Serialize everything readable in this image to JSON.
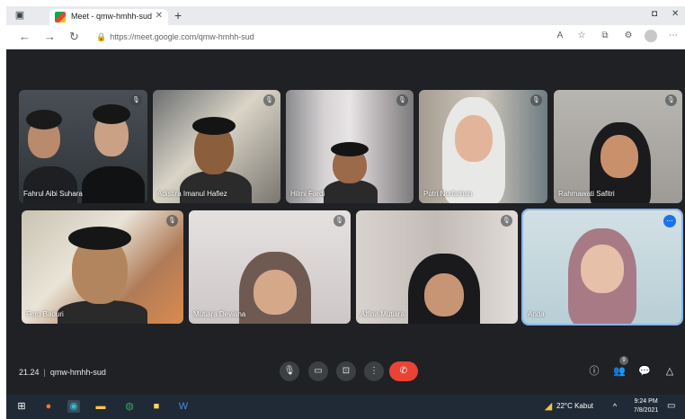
{
  "browser": {
    "tab_title": "Meet - qmw-hmhh-sud",
    "url": "https://meet.google.com/qmw-hmhh-sud",
    "new_tab": "+",
    "icons": [
      "back-arrow-icon",
      "forward-arrow-icon",
      "reload-icon",
      "lock-icon",
      "read-aloud-icon",
      "favorites-icon",
      "collections-icon",
      "extensions-icon",
      "profile-icon",
      "menu-icon"
    ]
  },
  "participants": [
    {
      "name": "Fahrul Aibi Suhara"
    },
    {
      "name": "Adistira Imanul Hafiez"
    },
    {
      "name": "Hilmi Fardi"
    },
    {
      "name": "Putri Nurfarhan"
    },
    {
      "name": "Rahmawati Safitri"
    },
    {
      "name": "Fero Baduri"
    },
    {
      "name": "Mutiara Deviana"
    },
    {
      "name": "Alfina Mutiara"
    },
    {
      "name": "Anda"
    }
  ],
  "meeting": {
    "time": "21.24",
    "separator": "|",
    "code": "qmw-hmhh-sud",
    "people_count": "9"
  },
  "colors": {
    "end_call": "#ea4335",
    "selected_tile": "#8ab4f8",
    "meet_bg": "#202124"
  },
  "taskbar": {
    "weather": "22°C Kabut",
    "time": "9:24 PM",
    "date": "7/8/2021"
  }
}
